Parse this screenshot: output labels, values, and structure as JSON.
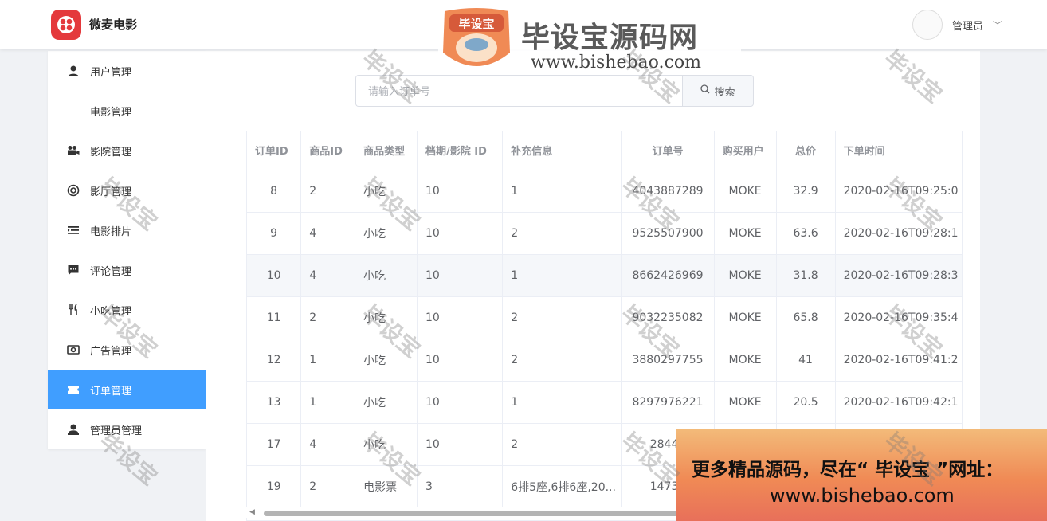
{
  "header": {
    "app_title": "微麦电影",
    "user_name": "管理员"
  },
  "sidebar": {
    "items": [
      {
        "label": "用户管理",
        "icon": "user-icon"
      },
      {
        "label": "电影管理",
        "icon": "none"
      },
      {
        "label": "影院管理",
        "icon": "camera-icon"
      },
      {
        "label": "影厅管理",
        "icon": "aperture-icon"
      },
      {
        "label": "电影排片",
        "icon": "list-icon"
      },
      {
        "label": "评论管理",
        "icon": "comment-icon"
      },
      {
        "label": "小吃管理",
        "icon": "fork-knife-icon"
      },
      {
        "label": "广告管理",
        "icon": "ad-icon"
      },
      {
        "label": "订单管理",
        "icon": "ticket-icon",
        "active": true
      },
      {
        "label": "管理员管理",
        "icon": "admin-icon"
      }
    ]
  },
  "search": {
    "placeholder": "请输入订单号",
    "button_label": "搜索"
  },
  "table": {
    "headers": [
      "订单ID",
      "商品ID",
      "商品类型",
      "档期/影院 ID",
      "补充信息",
      "订单号",
      "购买用户",
      "总价",
      "下单时间"
    ],
    "rows": [
      [
        "8",
        "2",
        "小吃",
        "10",
        "1",
        "4043887289",
        "MOKE",
        "32.9",
        "2020-02-16T09:25:0"
      ],
      [
        "9",
        "4",
        "小吃",
        "10",
        "2",
        "9525507900",
        "MOKE",
        "63.6",
        "2020-02-16T09:28:1"
      ],
      [
        "10",
        "4",
        "小吃",
        "10",
        "1",
        "8662426969",
        "MOKE",
        "31.8",
        "2020-02-16T09:28:3"
      ],
      [
        "11",
        "2",
        "小吃",
        "10",
        "2",
        "9032235082",
        "MOKE",
        "65.8",
        "2020-02-16T09:35:4"
      ],
      [
        "12",
        "1",
        "小吃",
        "10",
        "2",
        "3880297755",
        "MOKE",
        "41",
        "2020-02-16T09:41:2"
      ],
      [
        "13",
        "1",
        "小吃",
        "10",
        "1",
        "8297976221",
        "MOKE",
        "20.5",
        "2020-02-16T09:42:1"
      ],
      [
        "17",
        "4",
        "小吃",
        "10",
        "2",
        "28441",
        "",
        "",
        ""
      ],
      [
        "19",
        "2",
        "电影票",
        "3",
        "6排5座,6排6座,20...",
        "14732",
        "",
        "",
        ""
      ]
    ]
  },
  "watermark": {
    "text": "毕设宝"
  },
  "banner": {
    "title": "毕设宝源码网",
    "url": "www.bishebao.com",
    "mascot_text": "毕设宝"
  },
  "promo": {
    "line1": "更多精品源码，尽在“ 毕设宝 ”网址：",
    "line2": "www.bishebao.com"
  }
}
